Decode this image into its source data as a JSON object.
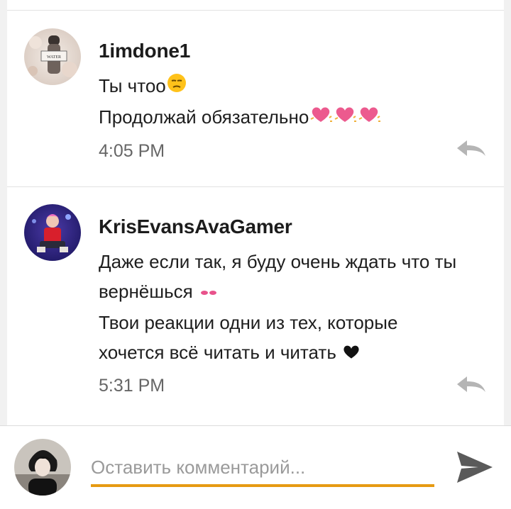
{
  "comments": [
    {
      "author": "1imdone1",
      "lines": [
        "Ты чтоо",
        "Продолжай обязательно"
      ],
      "time": "4:05 PM",
      "avatar_text": "WATER"
    },
    {
      "author": "KrisEvansAvaGamer",
      "lines": [
        "Даже если так, я буду очень ждать что ты",
        "вернёшься",
        "Твои реакции одни из тех, которые",
        "хочется всё читать и читать"
      ],
      "time": "5:31 PM"
    }
  ],
  "composer": {
    "placeholder": "Оставить комментарий..."
  },
  "icons": {
    "reply": "reply-arrow-icon",
    "send": "send-icon",
    "emoji_unamused": "unamused-face-emoji",
    "emoji_heart": "sparkling-heart-emoji",
    "emoji_lips": "lips-emoji",
    "emoji_black_heart": "black-heart-emoji"
  },
  "colors": {
    "accent": "#e69a12",
    "icon_gray": "#b5b5b5",
    "send_gray": "#5a5a5a"
  }
}
